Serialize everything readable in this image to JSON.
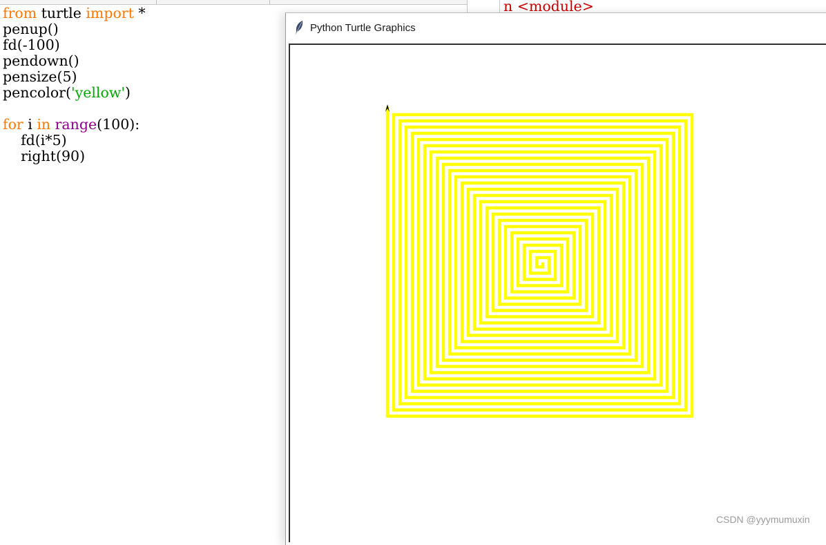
{
  "editor": {
    "code_lines": [
      [
        {
          "t": "from",
          "c": "kw"
        },
        {
          "t": " turtle ",
          "c": ""
        },
        {
          "t": "import",
          "c": "kw"
        },
        {
          "t": " *",
          "c": ""
        }
      ],
      [
        {
          "t": "penup()",
          "c": ""
        }
      ],
      [
        {
          "t": "fd(-100)",
          "c": ""
        }
      ],
      [
        {
          "t": "pendown()",
          "c": ""
        }
      ],
      [
        {
          "t": "pensize(5)",
          "c": ""
        }
      ],
      [
        {
          "t": "pencolor(",
          "c": ""
        },
        {
          "t": "'yellow'",
          "c": "str"
        },
        {
          "t": ")",
          "c": ""
        }
      ],
      [
        {
          "t": "",
          "c": ""
        }
      ],
      [
        {
          "t": "for",
          "c": "kw"
        },
        {
          "t": " i ",
          "c": ""
        },
        {
          "t": "in",
          "c": "kw"
        },
        {
          "t": " ",
          "c": ""
        },
        {
          "t": "range",
          "c": "bi"
        },
        {
          "t": "(100):",
          "c": ""
        }
      ],
      [
        {
          "t": "    fd(i*5)",
          "c": ""
        }
      ],
      [
        {
          "t": "    right(90)",
          "c": ""
        }
      ]
    ],
    "syntax_colors": {
      "keyword": "#ff7700",
      "builtin": "#900090",
      "string": "#00aa00",
      "default": "#000000"
    }
  },
  "shell": {
    "traceback_fragment": "n <module>",
    "error_color": "#cc0000"
  },
  "turtle_window": {
    "title": "Python Turtle Graphics",
    "app_icon": "feather-icon",
    "drawing": {
      "pen_color": "#ffff00",
      "pen_size": 5,
      "steps": 100,
      "step_increment": 5,
      "turn_degrees": 90,
      "turtle_color": "#000000"
    }
  },
  "watermark": "CSDN @yyymumuxin"
}
